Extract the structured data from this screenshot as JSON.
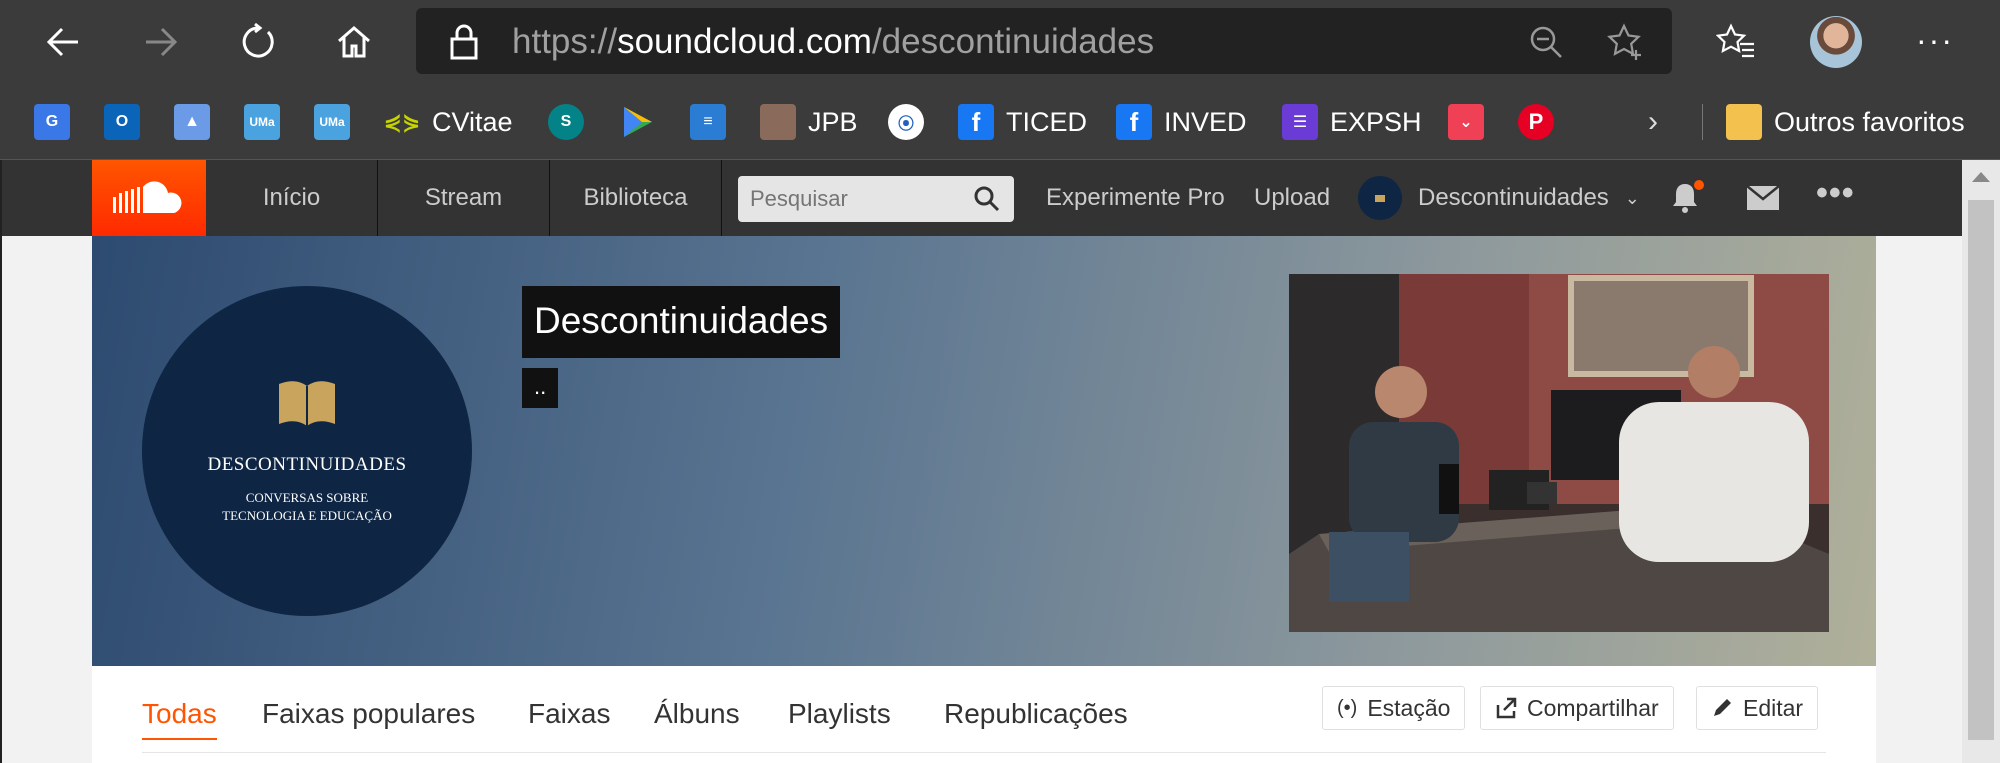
{
  "browser": {
    "url_prefix": "https://",
    "url_host": "soundcloud.com",
    "url_path": "/descontinuidades"
  },
  "favorites": {
    "items": [
      {
        "label": "",
        "icon": "google-translate-icon",
        "color": "#3b78e7"
      },
      {
        "label": "",
        "icon": "outlook-icon",
        "color": "#0a64b7"
      },
      {
        "label": "",
        "icon": "graduation-cap-icon",
        "color": "#6b9be6"
      },
      {
        "label": "",
        "icon": "uma-icon",
        "color": "#4aa3df"
      },
      {
        "label": "",
        "icon": "uma-icon",
        "color": "#4aa3df"
      },
      {
        "label": "CVitae",
        "icon": "cvitae-icon",
        "color": "#c8d400"
      },
      {
        "label": "",
        "icon": "sharepoint-icon",
        "color": "#038387"
      },
      {
        "label": "",
        "icon": "google-play-icon",
        "color": "#34a853"
      },
      {
        "label": "",
        "icon": "document-icon",
        "color": "#2b7cd3"
      },
      {
        "label": "JPB",
        "icon": "profile-photo-icon",
        "color": "#8a6a5a"
      },
      {
        "label": "",
        "icon": "flow-icon",
        "color": "#1f5fbf"
      },
      {
        "label": "TICED",
        "icon": "facebook-icon",
        "color": "#1877f2"
      },
      {
        "label": "INVED",
        "icon": "facebook-icon",
        "color": "#1877f2"
      },
      {
        "label": "EXPSH",
        "icon": "list-icon",
        "color": "#6b3bd6"
      },
      {
        "label": "",
        "icon": "pocket-icon",
        "color": "#ef4056"
      },
      {
        "label": "",
        "icon": "pinterest-icon",
        "color": "#e60023"
      }
    ],
    "other_label": "Outros favoritos"
  },
  "soundcloud": {
    "nav": [
      "Início",
      "Stream",
      "Biblioteca"
    ],
    "search_placeholder": "Pesquisar",
    "experiment_label": "Experimente Pro",
    "upload_label": "Upload",
    "user_label": "Descontinuidades"
  },
  "profile": {
    "name": "Descontinuidades",
    "subtitle": "..",
    "avatar_title": "DESCONTINUIDADES",
    "avatar_subtitle_1": "CONVERSAS SOBRE",
    "avatar_subtitle_2": "TECNOLOGIA E EDUCAÇÃO"
  },
  "tabs": [
    "Todas",
    "Faixas populares",
    "Faixas",
    "Álbuns",
    "Playlists",
    "Republicações"
  ],
  "actions": {
    "station": "Estação",
    "share": "Compartilhar",
    "edit": "Editar"
  },
  "colors": {
    "accent": "#ff5500",
    "header_bg": "#333333",
    "browser_bg": "#3b3b3b"
  }
}
